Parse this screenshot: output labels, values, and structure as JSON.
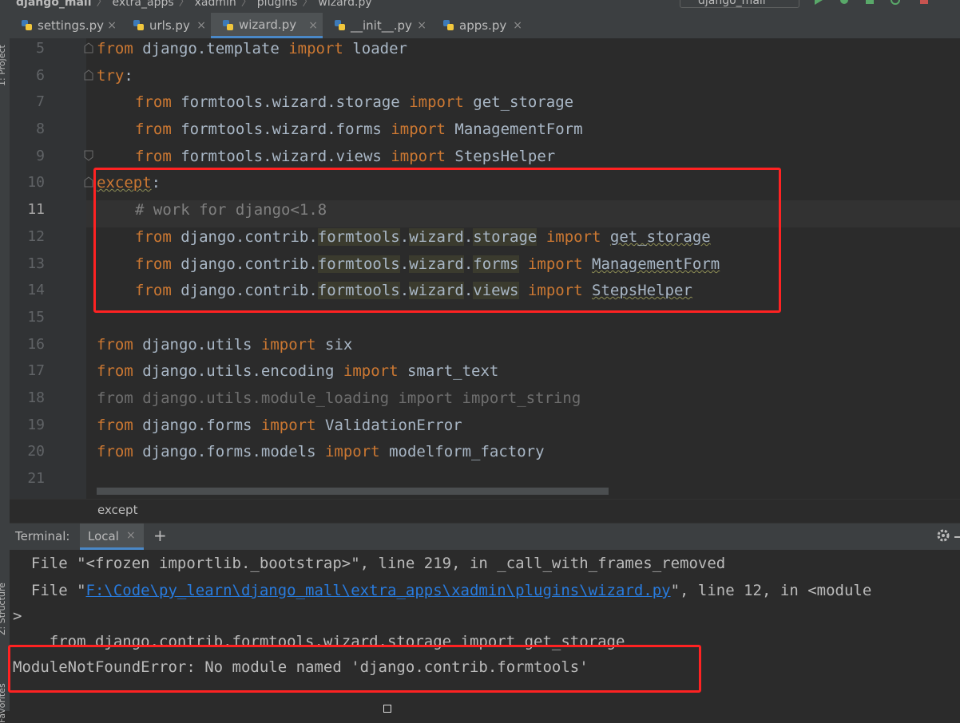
{
  "breadcrumbs": [
    "django_mall",
    "extra_apps",
    "xadmin",
    "plugins",
    "wizard.py"
  ],
  "run_config": "django_mall",
  "colors": {
    "bg": "#2b2b2b",
    "keyword": "#cc7832",
    "comment": "#808080",
    "text": "#a9b7c6",
    "highlight_box": "#ff2222",
    "link": "#287bde"
  },
  "left_strip": {
    "project_label": "1: Project",
    "structure_label": "Z: Structure",
    "favorites_label": "Favorites"
  },
  "tabs": [
    {
      "label": "settings.py",
      "icon": "python-file-icon",
      "active": false
    },
    {
      "label": "urls.py",
      "icon": "python-file-icon",
      "active": false
    },
    {
      "label": "wizard.py",
      "icon": "python-file-icon",
      "active": true
    },
    {
      "label": "__init__.py",
      "icon": "python-file-icon",
      "active": false
    },
    {
      "label": "apps.py",
      "icon": "python-file-icon",
      "active": false
    }
  ],
  "editor": {
    "line_numbers": [
      "5",
      "6",
      "7",
      "8",
      "9",
      "10",
      "11",
      "12",
      "13",
      "14",
      "15",
      "16",
      "17",
      "18",
      "19",
      "20",
      "21"
    ],
    "current_line": "11",
    "lines": {
      "l5": {
        "kw1": "from",
        "mod": " django.template ",
        "kw2": "import",
        "name": " loader"
      },
      "l6": {
        "kw1": "try",
        "rest": ":"
      },
      "l7": {
        "kw1": "from",
        "mod": " formtools.wizard.storage ",
        "kw2": "import",
        "name": " get_storage"
      },
      "l8": {
        "kw1": "from",
        "mod": " formtools.wizard.forms ",
        "kw2": "import",
        "name": " ManagementForm"
      },
      "l9": {
        "kw1": "from",
        "mod": " formtools.wizard.views ",
        "kw2": "import",
        "name": " StepsHelper"
      },
      "l10": {
        "kw1": "except",
        "rest": ":"
      },
      "l11": {
        "comment": "# work for django<1.8"
      },
      "l12": {
        "kw1": "from",
        "pre": " django.contrib.",
        "p1": "formtools",
        "p2": "wizard",
        "p3": "storage",
        "kw2": "import",
        "name": "get_storage"
      },
      "l13": {
        "kw1": "from",
        "pre": " django.contrib.",
        "p1": "formtools",
        "p2": "wizard",
        "p3": "forms",
        "kw2": "import",
        "name": "ManagementForm"
      },
      "l14": {
        "kw1": "from",
        "pre": " django.contrib.",
        "p1": "formtools",
        "p2": "wizard",
        "p3": "views",
        "kw2": "import",
        "name": "StepsHelper"
      },
      "l16": {
        "kw1": "from",
        "mod": " django.utils ",
        "kw2": "import",
        "name": " six"
      },
      "l17": {
        "kw1": "from",
        "mod": " django.utils.encoding ",
        "kw2": "import",
        "name": " smart_text"
      },
      "l18": {
        "text": "from django.utils.module_loading import import_string"
      },
      "l19": {
        "kw1": "from",
        "mod": " django.forms ",
        "kw2": "import",
        "name": " ValidationError"
      },
      "l20": {
        "kw1": "from",
        "mod": " django.forms.models ",
        "kw2": "import",
        "name": " modelform_factory"
      }
    }
  },
  "editor_breadcrumb": "except",
  "terminal": {
    "title": "Terminal:",
    "tab_label": "Local",
    "add_label": "+",
    "lines": {
      "t1": "  File \"<frozen importlib._bootstrap>\", line 219, in _call_with_frames_removed",
      "t2_pre": "  File \"",
      "t2_link": "F:\\Code\\py_learn\\django_mall\\extra_apps\\xadmin\\plugins\\wizard.py",
      "t2_post": "\", line 12, in <module",
      "t3": ">",
      "t4": "    from django.contrib.formtools.wizard.storage import get_storage",
      "t5": "ModuleNotFoundError: No module named 'django.contrib.formtools'"
    }
  }
}
